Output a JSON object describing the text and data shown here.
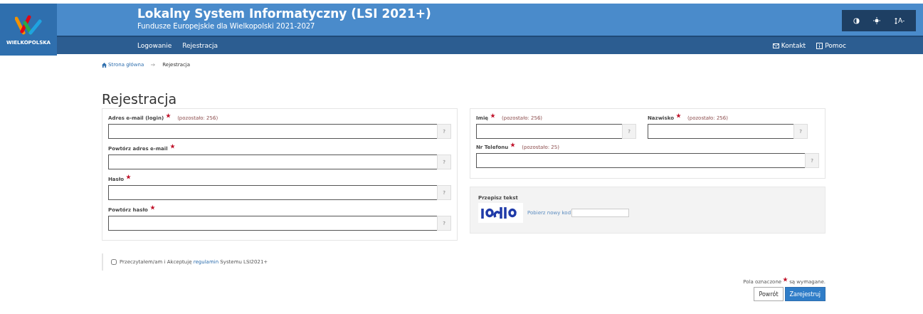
{
  "header": {
    "logo_text": "WIELKOPOLSKA",
    "title": "Lokalny System Informatyczny (LSI 2021+)",
    "subtitle": "Fundusze Europejskie dla Wielkopolski 2021-2027",
    "font_size_label": "A-"
  },
  "nav": {
    "items": [
      {
        "label": "Logowanie",
        "selected": false
      },
      {
        "label": "Rejestracja",
        "selected": false
      }
    ],
    "right": [
      {
        "label": "Kontakt",
        "kind": "mail"
      },
      {
        "label": "Pomoc",
        "kind": "info"
      }
    ]
  },
  "breadcrumb": [
    {
      "label": "Strona główna",
      "kind": "home"
    },
    {
      "label": "Rejestracja",
      "kind": "current"
    }
  ],
  "page_title": "Rejestracja",
  "left_fields": [
    {
      "label": "Adres e-mail (login)",
      "required": true,
      "remaining": "(pozostało: 256)",
      "help": "?"
    },
    {
      "label": "Powtórz adres e-mail",
      "required": true,
      "help": "?"
    },
    {
      "label": "Hasło",
      "required": true,
      "help": "?"
    },
    {
      "label": "Powtórz hasło",
      "required": true,
      "help": "?"
    }
  ],
  "right_fields": [
    {
      "label": "Imię",
      "required": true,
      "remaining": "(pozostało: 256)",
      "help": "?",
      "kind": "half"
    },
    {
      "label": "Nazwisko",
      "required": true,
      "remaining": "(pozostało: 256)",
      "help": "?",
      "kind": "half"
    },
    {
      "label": "Nr Telefonu",
      "required": true,
      "remaining": "(pozostało: 25)",
      "help": "?",
      "kind": "full"
    }
  ],
  "captcha": {
    "label": "Przepisz tekst",
    "link": "Pobierz nowy kod"
  },
  "consent": {
    "checked": false,
    "before": "Przeczytałem/am i Akceptuję",
    "link": "regulamin",
    "after": "Systemu LSI2021+"
  },
  "required_note": {
    "before": "Pola oznaczone",
    "after": "są wymagane."
  },
  "buttons": [
    {
      "label": "Powrót",
      "kind": "secondary"
    },
    {
      "label": "Zarejestruj",
      "kind": "primary"
    }
  ]
}
